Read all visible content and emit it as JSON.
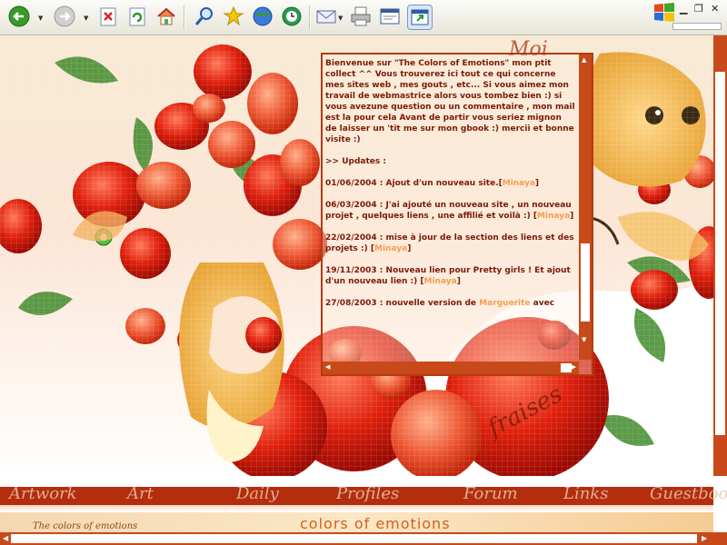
{
  "toolbar": {
    "buttons": [
      "back-icon",
      "forward-icon",
      "stop-icon",
      "refresh-icon",
      "home-icon",
      "search-icon",
      "favorites-icon",
      "media-icon",
      "history-icon",
      "mail-icon",
      "print-icon",
      "edit-icon",
      "messenger-icon"
    ]
  },
  "colors": {
    "accent": "#c84a1a",
    "panel_text": "#7a1a06",
    "link": "#f0a050",
    "nav_bg": "#b42d0c"
  },
  "panel": {
    "welcome": "Bienvenue sur \"The Colors of Emotions\" mon ptit collect ^^ Vous trouverez ici tout ce qui concerne mes sites web , mes gouts , etc... Si vous aimez mon travail de webmastrice alors vous tombez bien :) si vous avezune question ou un commentaire , mon mail est la pour cela Avant de partir vous seriez mignon de laisser un 'tit me sur mon gbook :) mercii et bonne visite :)",
    "updates_label": ">> Updates :",
    "updates": [
      {
        "text": "01/06/2004 : Ajout d'un nouveau site.[",
        "link": "Minaya",
        "end": "]"
      },
      {
        "text": "06/03/2004 : J'ai ajouté un nouveau site , un nouveau projet , quelques liens , une affilié et voilà :) [",
        "link": "Minaya",
        "end": "]"
      },
      {
        "text": "22/02/2004 : mise à jour de la section des liens et des projets :) [",
        "link": "Minaya",
        "end": "]"
      },
      {
        "text": "19/11/2003 : Nouveau lien pour Pretty girls ! Et ajout d'un nouveau lien :) [",
        "link": "Minaya",
        "end": "]"
      },
      {
        "text": "27/08/2003 : nouvelle version de ",
        "link": "Marguerite",
        "end": " avec"
      }
    ]
  },
  "nav": {
    "items": [
      "Artwork",
      "Art",
      "Daily",
      "Profiles",
      "Forum",
      "Links",
      "Guestbook"
    ]
  },
  "banner": {
    "text": "The colors of emotions",
    "title": "colors of emotions"
  }
}
